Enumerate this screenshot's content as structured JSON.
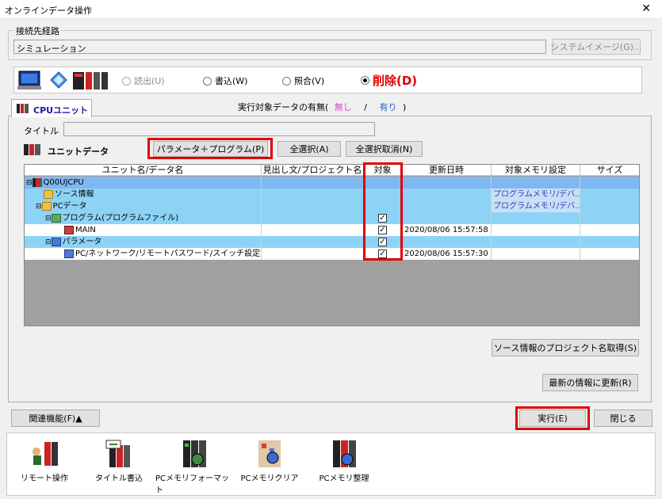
{
  "window": {
    "title": "オンラインデータ操作",
    "close": "✕"
  },
  "route": {
    "group_label": "接続先経路",
    "value": "シミュレーション",
    "system_image_button": "システムイメージ(G)..."
  },
  "mode": {
    "read": "読出(U)",
    "write": "書込(W)",
    "verify": "照合(V)",
    "delete": "削除(D)",
    "selected": "delete"
  },
  "tab": {
    "label": "CPUユニット"
  },
  "presence": {
    "prefix": "実行対象データの有無(",
    "none": "無し",
    "sep": "/",
    "yes": "有り",
    "suffix": ")"
  },
  "title_field": {
    "label": "タイトル",
    "value": ""
  },
  "unit_data": {
    "label": "ユニットデータ",
    "param_prog_button": "パラメータ＋プログラム(P)",
    "select_all_button": "全選択(A)",
    "deselect_all_button": "全選択取消(N)"
  },
  "table": {
    "headers": [
      "ユニット名/データ名",
      "見出し文/プロジェクト名",
      "対象",
      "更新日時",
      "対象メモリ設定",
      "サイズ"
    ],
    "rows": [
      {
        "name": "Q00UJCPU",
        "heading": "",
        "checked": false,
        "date": "",
        "memory": "",
        "size": ""
      },
      {
        "name": "ソース情報",
        "heading": "",
        "checked": false,
        "date": "",
        "memory": "プログラムメモリ/デバ...",
        "size": ""
      },
      {
        "name": "PCデータ",
        "heading": "",
        "checked": false,
        "date": "",
        "memory": "プログラムメモリ/デバ...",
        "size": ""
      },
      {
        "name": "プログラム(プログラムファイル)",
        "heading": "",
        "checked": true,
        "date": "",
        "memory": "",
        "size": ""
      },
      {
        "name": "MAIN",
        "heading": "",
        "checked": true,
        "date": "2020/08/06 15:57:58",
        "memory": "",
        "size": ""
      },
      {
        "name": "パラメータ",
        "heading": "",
        "checked": true,
        "date": "",
        "memory": "",
        "size": ""
      },
      {
        "name": "PC/ネットワーク/リモートパスワード/スイッチ設定",
        "heading": "",
        "checked": true,
        "date": "2020/08/06 15:57:30",
        "memory": "",
        "size": ""
      }
    ]
  },
  "buttons": {
    "get_project_name": "ソース情報のプロジェクト名取得(S)",
    "refresh": "最新の情報に更新(R)",
    "related": "関連機能(F)▲",
    "execute": "実行(E)",
    "close": "閉じる"
  },
  "toolbar": [
    {
      "label": "リモート操作",
      "icon": "remote-operation-icon"
    },
    {
      "label": "タイトル書込",
      "icon": "title-write-icon"
    },
    {
      "label": "PCメモリフォーマット",
      "icon": "pc-memory-format-icon"
    },
    {
      "label": "PCメモリクリア",
      "icon": "pc-memory-clear-icon"
    },
    {
      "label": "PCメモリ整理",
      "icon": "pc-memory-arrange-icon"
    }
  ],
  "colors": {
    "highlight_red": "#e00000",
    "row_blue": "#8dd3f6",
    "row_blue_dark": "#7fb8f0",
    "presence_none": "#d04bd0",
    "presence_yes": "#1e5fd6",
    "memory_text": "#3b2fc9"
  }
}
